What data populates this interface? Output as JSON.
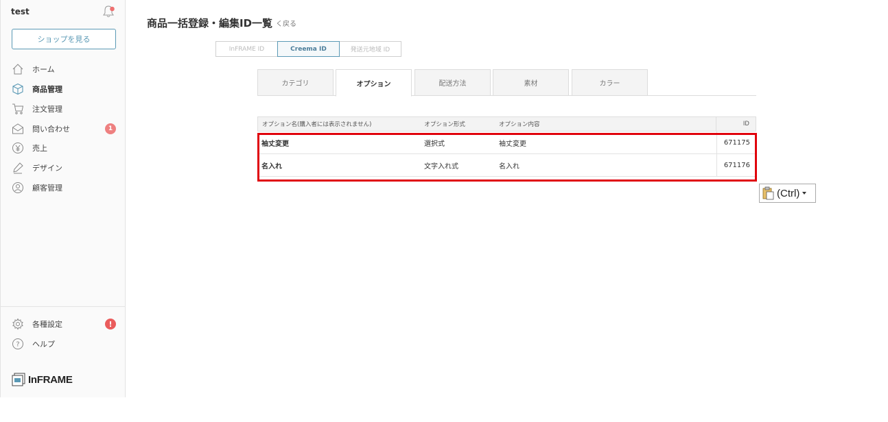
{
  "sidebar": {
    "store_name": "test",
    "shop_button": "ショップを見る",
    "nav": [
      {
        "label": "ホーム",
        "icon": "home-icon"
      },
      {
        "label": "商品管理",
        "icon": "box-icon"
      },
      {
        "label": "注文管理",
        "icon": "cart-icon"
      },
      {
        "label": "問い合わせ",
        "icon": "mail-icon",
        "badge": "1"
      },
      {
        "label": "売上",
        "icon": "yen-icon"
      },
      {
        "label": "デザイン",
        "icon": "pen-icon"
      },
      {
        "label": "顧客管理",
        "icon": "person-icon"
      }
    ],
    "bottom_nav": [
      {
        "label": "各種設定",
        "icon": "gear-icon",
        "badge": "!"
      },
      {
        "label": "ヘルプ",
        "icon": "help-icon"
      }
    ],
    "logo_text": "InFRAME"
  },
  "header": {
    "title": "商品一括登録・編集ID一覧",
    "back": "く戻る"
  },
  "id_switch": [
    "InFRAME ID",
    "Creema ID",
    "発送元地域 ID"
  ],
  "tabs": [
    "カテゴリ",
    "オプション",
    "配送方法",
    "素材",
    "カラー"
  ],
  "table": {
    "columns": [
      "オプション名(購入者には表示されません)",
      "オプション形式",
      "オプション内容",
      "ID"
    ],
    "rows": [
      {
        "name": "袖丈変更",
        "type": "選択式",
        "content": "袖丈変更",
        "id": "671175"
      },
      {
        "name": "名入れ",
        "type": "文字入れ式",
        "content": "名入れ",
        "id": "671176"
      }
    ]
  },
  "paste_button": "(Ctrl)",
  "colors": {
    "accent": "#5a99b5",
    "highlight": "#e0000b",
    "badge": "#ee8080"
  }
}
